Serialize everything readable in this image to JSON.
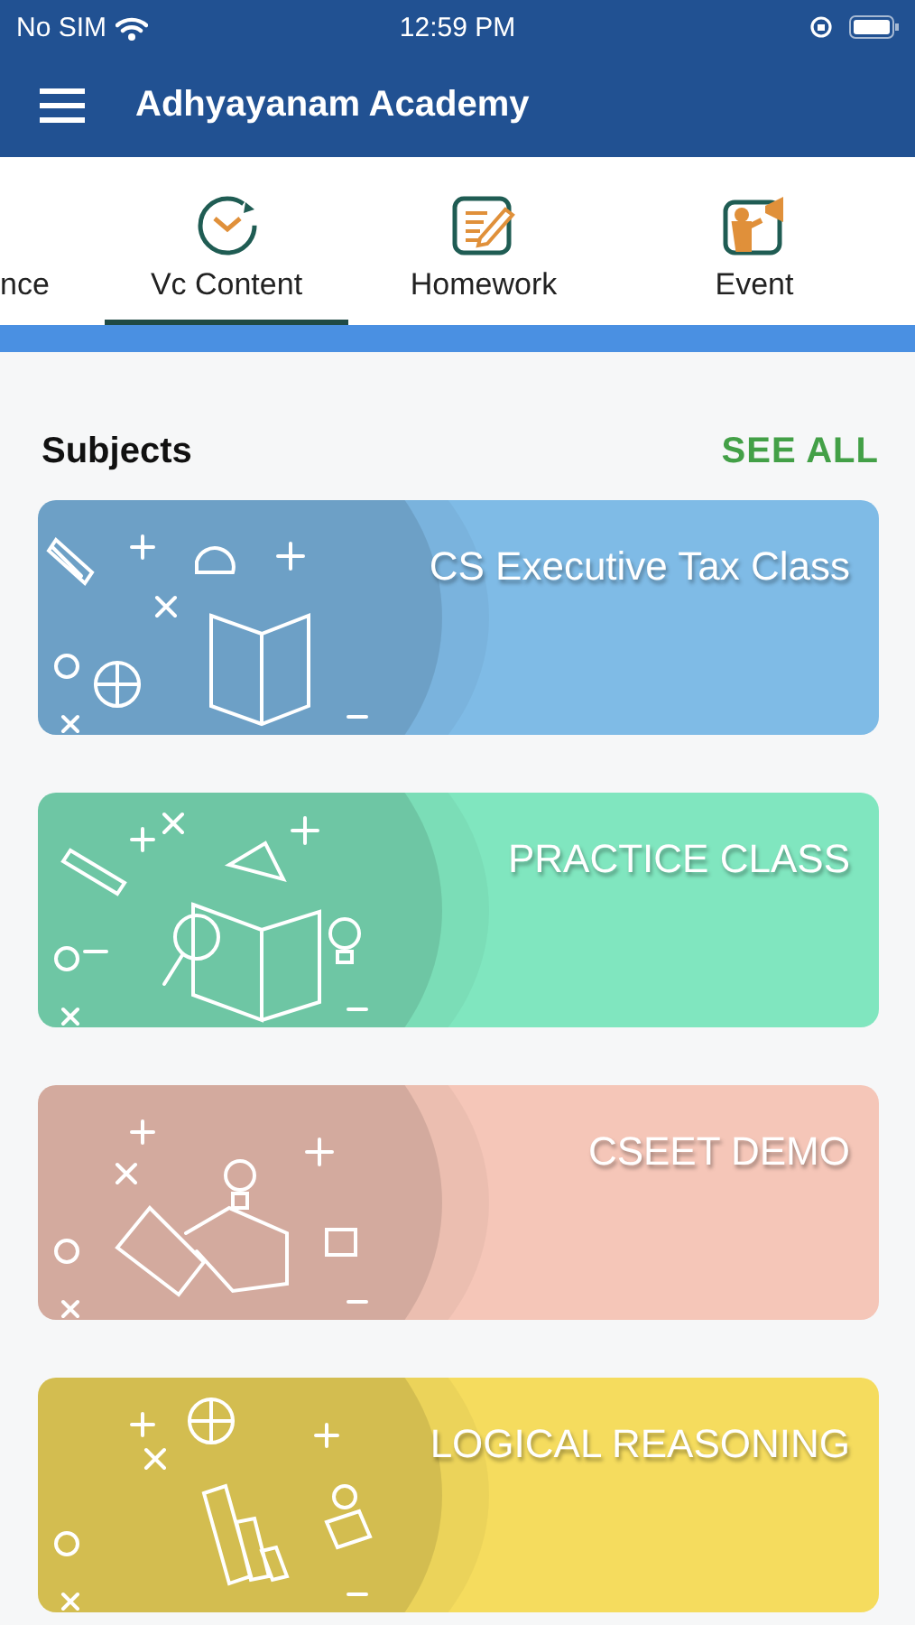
{
  "status_bar": {
    "carrier": "No SIM",
    "time": "12:59 PM"
  },
  "app_bar": {
    "title": "Adhyayanam Academy"
  },
  "tabs": [
    {
      "label": "nce",
      "kind": "none",
      "selected": false
    },
    {
      "label": "Vc Content",
      "kind": "clock",
      "selected": true
    },
    {
      "label": "Homework",
      "kind": "notepad",
      "selected": false
    },
    {
      "label": "Event",
      "kind": "speaker",
      "selected": false
    }
  ],
  "section": {
    "title": "Subjects",
    "action": "SEE ALL"
  },
  "subjects": [
    {
      "title": "CS Executive Tax Class",
      "color": "#7fbbe6",
      "kind": "book"
    },
    {
      "title": "PRACTICE CLASS",
      "color": "#80e6bf",
      "kind": "search"
    },
    {
      "title": "CSEET DEMO",
      "color": "#f5c6b8",
      "kind": "handshake"
    },
    {
      "title": "LOGICAL REASONING",
      "color": "#f5dc5e",
      "kind": "chart"
    }
  ]
}
